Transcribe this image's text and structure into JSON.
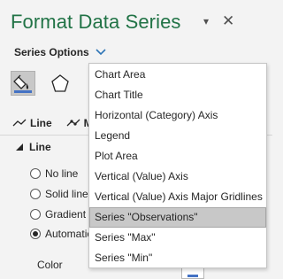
{
  "pane": {
    "title": "Format Data Series",
    "pin_glyph": "▾",
    "close_glyph": "✕",
    "series_options_label": "Series Options"
  },
  "tabs": {
    "fill_line_icon": "paint-bucket-icon",
    "effects_icon": "pentagon-icon",
    "line_tab_label": "Line",
    "marker_tab_label": "M"
  },
  "section": {
    "title": "Line"
  },
  "line_options": [
    {
      "label": "No line",
      "checked": false
    },
    {
      "label": "Solid line",
      "checked": false
    },
    {
      "label": "Gradient",
      "checked": false
    },
    {
      "label": "Automatic",
      "checked": true
    }
  ],
  "color_label": "Color",
  "menu": {
    "items": [
      "Chart Area",
      "Chart Title",
      "Horizontal (Category) Axis",
      "Legend",
      "Plot Area",
      "Vertical (Value) Axis",
      "Vertical (Value) Axis Major Gridlines",
      "Series \"Observations\"",
      "Series \"Max\"",
      "Series \"Min\""
    ],
    "selected_index": 7
  },
  "colors": {
    "title_green": "#217346",
    "accent_blue": "#2e75b6",
    "swatch_blue": "#4472c4"
  }
}
